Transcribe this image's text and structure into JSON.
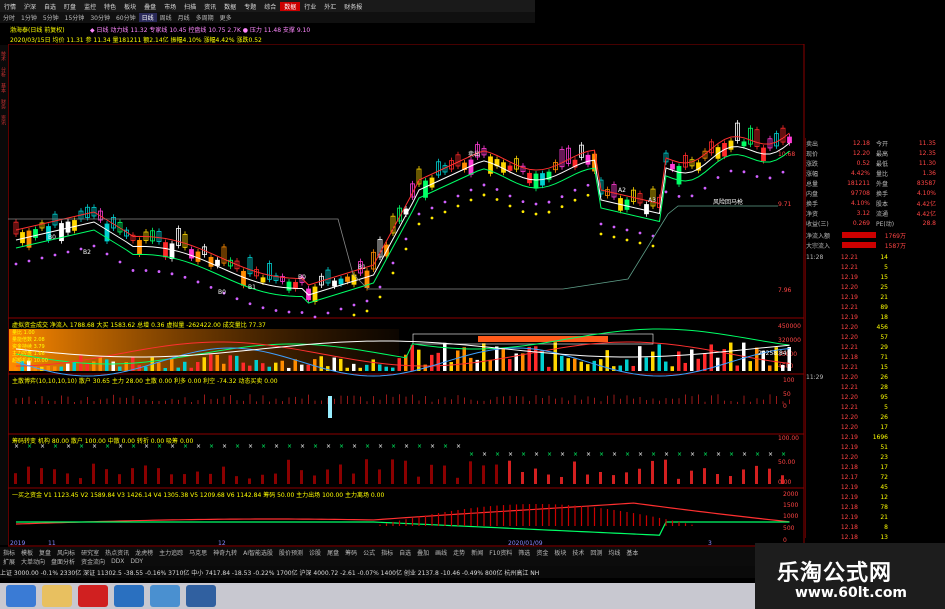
{
  "menu": [
    "行情",
    "沪深",
    "自选",
    "盯盘",
    "监控",
    "特色",
    "板块",
    "叠盘",
    "市场",
    "扫描",
    "资讯",
    "数据",
    "专题",
    "综合",
    "数据",
    "行业",
    "外汇",
    "财务报"
  ],
  "menu_selected": 14,
  "periods": [
    "分时",
    "1分钟",
    "5分钟",
    "15分钟",
    "30分钟",
    "60分钟",
    "日线",
    "周线",
    "月线",
    "多周期",
    "更多"
  ],
  "period_selected": 6,
  "stock_title": "渤海泰(日线 前复权)",
  "main_info_1": "◆ 日线   动力线 11.32  专家线 10.45  控盘线 10.75  2.7K   ● 压力 11.48  支撑 9.10",
  "main_info_2": "2020/03/15日  均价 11.31  参 11.34  量181211  额2.14亿  振幅4.10%  涨幅4.42%  涨跌0.52",
  "main_scale": [
    "10.68",
    "9.71",
    "7.96"
  ],
  "main_annotations": [
    "B0",
    "B2",
    "B0",
    "B1",
    "B0",
    "B1",
    "卖出",
    "A2",
    "A3",
    "风险回马枪"
  ],
  "panel1_title": "虚拟资金成交  净流入 1788.68  大买 1583.62  总增 0.36  虚拟量 -262422.00  成交量比 77.37",
  "panel1_legend": [
    "量比 1.00",
    "量能倍数 2.08",
    "资金持续 3.79",
    "主力控盘 1.66",
    "超额机构 10.00"
  ],
  "panel1_scale": [
    "450000",
    "320000",
    "15000",
    "4500"
  ],
  "panel1_value": "29258.84",
  "panel2_title": "主散博弈(10,10,10,10)  散户 30.65  主力 28.00  主散 0.00  利多 0.00  利空 -74.32  动态买卖 0.00",
  "panel2_scale": [
    "100",
    "50",
    "0"
  ],
  "panel3_title": "筹码转变  机构 80.00  散户 100.00  中散 0.00  转折 0.00  吸筹 0.00",
  "panel3_scale": [
    "100.00",
    "50.00",
    "0.00"
  ],
  "panel4_title": "一买之资金  V1 1123.45  V2 1589.84  V3 1426.14  V4 1305.38  V5 1209.68  V6 1142.84  筹码 50.00  主力出场 100.00  主力离场 0.00",
  "panel4_scale": [
    "2000",
    "1500",
    "1000",
    "500",
    "0"
  ],
  "xaxis_labels": [
    "2019",
    "11",
    "12",
    "2020/01/09",
    "3"
  ],
  "right_quote": [
    {
      "k": "卖出",
      "v": "12.18",
      "k2": "今开",
      "v2": "11.35"
    },
    {
      "k": "现价",
      "v": "12.20",
      "k2": "最高",
      "v2": "12.35"
    },
    {
      "k": "涨跌",
      "v": "0.52",
      "k2": "最低",
      "v2": "11.30"
    },
    {
      "k": "涨幅",
      "v": "4.42%",
      "k2": "量比",
      "v2": "1.36"
    },
    {
      "k": "总量",
      "v": "181211",
      "k2": "外盘",
      "v2": "83587"
    },
    {
      "k": "内盘",
      "v": "97708",
      "k2": "换手",
      "v2": "4.10%"
    },
    {
      "k": "换手",
      "v": "4.10%",
      "k2": "股本",
      "v2": "4.42亿"
    },
    {
      "k": "净资",
      "v": "3.12",
      "k2": "流通",
      "v2": "4.42亿"
    },
    {
      "k": "收益(三)",
      "v": "0.269",
      "k2": "PE(动)",
      "v2": "28.8"
    }
  ],
  "right_bars": [
    {
      "label": "净流入额",
      "value": "1769万"
    },
    {
      "label": "大宗流入",
      "value": "1587万"
    }
  ],
  "ticks": [
    {
      "t": "11:28",
      "p": "12.21",
      "q": "14"
    },
    {
      "t": "",
      "p": "12.21",
      "q": "5"
    },
    {
      "t": "",
      "p": "12.19",
      "q": "15"
    },
    {
      "t": "",
      "p": "12.20",
      "q": "25"
    },
    {
      "t": "",
      "p": "12.19",
      "q": "21"
    },
    {
      "t": "",
      "p": "12.21",
      "q": "89"
    },
    {
      "t": "",
      "p": "12.19",
      "q": "18"
    },
    {
      "t": "",
      "p": "12.20",
      "q": "456"
    },
    {
      "t": "",
      "p": "12.20",
      "q": "57"
    },
    {
      "t": "",
      "p": "12.21",
      "q": "29"
    },
    {
      "t": "",
      "p": "12.18",
      "q": "71"
    },
    {
      "t": "",
      "p": "12.21",
      "q": "15"
    },
    {
      "t": "11:29",
      "p": "12.20",
      "q": "26"
    },
    {
      "t": "",
      "p": "12.21",
      "q": "28"
    },
    {
      "t": "",
      "p": "12.20",
      "q": "95"
    },
    {
      "t": "",
      "p": "12.21",
      "q": "5"
    },
    {
      "t": "",
      "p": "12.20",
      "q": "26"
    },
    {
      "t": "",
      "p": "12.20",
      "q": "17"
    },
    {
      "t": "",
      "p": "12.19",
      "q": "1696"
    },
    {
      "t": "",
      "p": "12.19",
      "q": "51"
    },
    {
      "t": "",
      "p": "12.20",
      "q": "23"
    },
    {
      "t": "",
      "p": "12.18",
      "q": "17"
    },
    {
      "t": "",
      "p": "12.17",
      "q": "72"
    },
    {
      "t": "",
      "p": "12.19",
      "q": "45"
    },
    {
      "t": "",
      "p": "12.19",
      "q": "12"
    },
    {
      "t": "",
      "p": "12.18",
      "q": "78"
    },
    {
      "t": "",
      "p": "12.19",
      "q": "21"
    },
    {
      "t": "",
      "p": "12.18",
      "q": "8"
    },
    {
      "t": "",
      "p": "12.18",
      "q": "13"
    },
    {
      "t": "",
      "p": "12.18",
      "q": "12"
    },
    {
      "t": "",
      "p": "12.19",
      "q": "8"
    }
  ],
  "bottom_nav": [
    "指标",
    "模板",
    "复盘",
    "风向标",
    "研究室",
    "热点资讯",
    "龙虎榜",
    "主力追踪",
    "马克思",
    "神奇九转",
    "AI智能选股",
    "股价预测",
    "诊股",
    "尾盘",
    "筹码",
    "公式",
    "指标",
    "自选",
    "叠加",
    "画线",
    "走势",
    "新闻",
    "F10资料",
    "筛选",
    "资金",
    "板块",
    "技术",
    "回测",
    "均线",
    "基本"
  ],
  "bottom_nav2": [
    "扩展",
    "大单动向",
    "盘面分析",
    "资金流向",
    "DDX",
    "DDY"
  ],
  "status_bar": "上证 3000.00 -0.1% 2330亿  深证 11302.5 -38.55 -0.16% 3710亿  中小 7417.84 -18.53 -0.22% 1700亿  沪深 4000.72 -2.61 -0.07% 1400亿  创业 2137.8 -10.46 -0.49% 800亿  杭州高江 NH",
  "watermark": {
    "title": "乐淘公式网",
    "url": "www.60lt.com"
  },
  "colors": {
    "up": "#ff2a2a",
    "down": "#00d0d0",
    "accent": "#c00000"
  }
}
